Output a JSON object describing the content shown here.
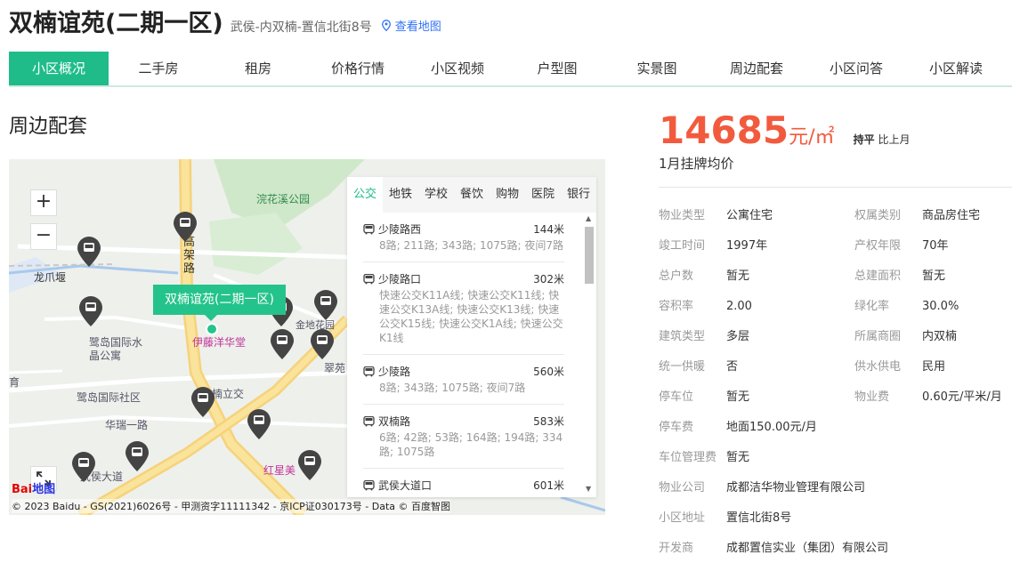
{
  "header": {
    "title": "双楠谊苑(二期一区)",
    "address": "武侯-内双楠-置信北街8号",
    "map_link": "查看地图"
  },
  "tabs": [
    "小区概况",
    "二手房",
    "租房",
    "价格行情",
    "小区视频",
    "户型图",
    "实景图",
    "周边配套",
    "小区问答",
    "小区解读"
  ],
  "section_title": "周边配套",
  "map": {
    "zoom_in": "+",
    "zoom_out": "−",
    "callout": "双楠谊苑(二期一区)",
    "labels": {
      "park": "浣花溪公园",
      "road_vertical": "高架路",
      "longzhuayan": "龙爪堰",
      "crystal": "鹭岛国际水晶公寓",
      "shop": "伊藤洋华堂",
      "jindi": "金地花园",
      "ludao_community": "鹭岛国际社区",
      "nanlijiao": "楠立交",
      "huarui": "华瑞一路",
      "wuhou": "武侯大道",
      "hongxing": "红星美",
      "cuiyuan": "翠苑",
      "edge_yu": "育"
    },
    "logo_red": "Bai",
    "logo_blue": "地图",
    "copyright": "© 2023 Baidu - GS(2021)6026号 - 甲测资字11111342 - 京ICP证030173号 - Data © 百度智图"
  },
  "poi": {
    "tabs": [
      "公交",
      "地铁",
      "学校",
      "餐饮",
      "购物",
      "医院",
      "银行"
    ],
    "items": [
      {
        "name": "少陵路西",
        "dist": "144米",
        "desc": "8路; 211路; 343路; 1075路; 夜间7路"
      },
      {
        "name": "少陵路口",
        "dist": "302米",
        "desc": "快速公交K11A线; 快速公交K11线; 快速公交K13A线; 快速公交K13线; 快速公交K15线; 快速公交K1A线; 快速公交K1线"
      },
      {
        "name": "少陵路",
        "dist": "560米",
        "desc": "8路; 343路; 1075路; 夜间7路"
      },
      {
        "name": "双楠路",
        "dist": "583米",
        "desc": "6路; 42路; 53路; 164路; 194路; 334路; 1075路"
      },
      {
        "name": "武侯大道口",
        "dist": "601米",
        "desc": ""
      }
    ]
  },
  "price": {
    "value": "14685",
    "unit": "元/㎡",
    "trend_flat": "持平",
    "trend_label": "比上月",
    "sub": "1月挂牌均价"
  },
  "props": [
    [
      {
        "k": "物业类型",
        "v": "公寓住宅"
      },
      {
        "k": "权属类别",
        "v": "商品房住宅"
      }
    ],
    [
      {
        "k": "竣工时间",
        "v": "1997年"
      },
      {
        "k": "产权年限",
        "v": "70年"
      }
    ],
    [
      {
        "k": "总户数",
        "v": "暂无"
      },
      {
        "k": "总建面积",
        "v": "暂无"
      }
    ],
    [
      {
        "k": "容积率",
        "v": "2.00"
      },
      {
        "k": "绿化率",
        "v": "30.0%"
      }
    ],
    [
      {
        "k": "建筑类型",
        "v": "多层"
      },
      {
        "k": "所属商圈",
        "v": "内双楠"
      }
    ],
    [
      {
        "k": "统一供暖",
        "v": "否"
      },
      {
        "k": "供水供电",
        "v": "民用"
      }
    ],
    [
      {
        "k": "停车位",
        "v": "暂无"
      },
      {
        "k": "物业费",
        "v": "0.60元/平米/月"
      }
    ],
    [
      {
        "k": "停车费",
        "v": "地面150.00元/月"
      }
    ],
    [
      {
        "k": "车位管理费",
        "v": "暂无"
      }
    ],
    [
      {
        "k": "物业公司",
        "v": "成都洁华物业管理有限公司"
      }
    ],
    [
      {
        "k": "小区地址",
        "v": "置信北街8号"
      }
    ],
    [
      {
        "k": "开发商",
        "v": "成都置信实业（集团）有限公司"
      }
    ]
  ],
  "colors": {
    "accent": "#1fbc8a",
    "price": "#f25a3e",
    "link": "#3072f6"
  }
}
